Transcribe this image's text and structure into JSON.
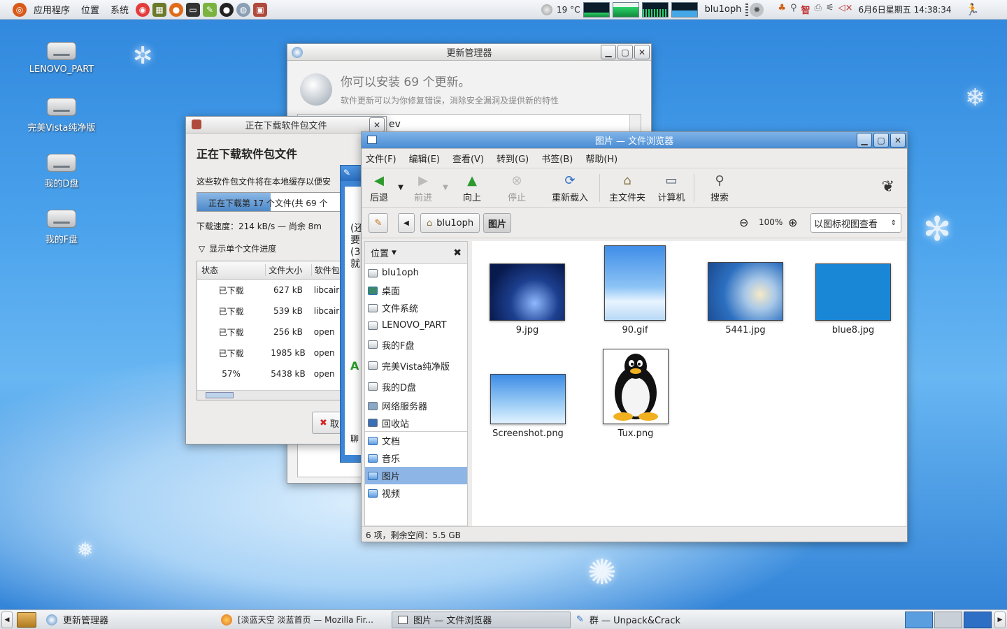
{
  "topbar": {
    "menus": [
      "应用程序",
      "位置",
      "系统"
    ],
    "temperature": "19 °C",
    "username": "blu1oph",
    "datetime": "6月6日星期五 14:38:34",
    "launchers": [
      "help-icon",
      "calculator-icon",
      "firefox-icon",
      "terminal-icon",
      "pidgin-icon",
      "qq-icon",
      "network-icon",
      "package-icon"
    ]
  },
  "desktop": {
    "icons": [
      "LENOVO_PART",
      "完美Vista纯净版",
      "我的D盘",
      "我的F盘"
    ]
  },
  "update_manager": {
    "title": "更新管理器",
    "heading": "你可以安装 69 个更新。",
    "subtitle": "软件更新可以为你修复错误，消除安全漏洞及提供新的特性",
    "list_text": "ev"
  },
  "download_dialog": {
    "title": "正在下载软件包文件",
    "heading": "正在下载软件包文件",
    "description": "这些软件包文件将在本地缓存以便安",
    "progress_text": "正在下载第 17 个文件(共 69 个",
    "progress": 0.41,
    "speed": "下载速度：214 kB/s — 尚余 8m",
    "toggle": "显示单个文件进度",
    "columns": [
      "状态",
      "文件大小",
      "软件包"
    ],
    "rows": [
      {
        "status": "已下载",
        "size": "627 kB",
        "pkg": "libcair"
      },
      {
        "status": "已下载",
        "size": "539 kB",
        "pkg": "libcair"
      },
      {
        "status": "已下载",
        "size": "256 kB",
        "pkg": "open"
      },
      {
        "status": "已下载",
        "size": "1985 kB",
        "pkg": "open"
      },
      {
        "status": "57%",
        "size": "5438 kB",
        "pkg": "open"
      }
    ],
    "cancel": "取"
  },
  "chat_window": {
    "lines": [
      "(还",
      "要",
      "(3",
      "就"
    ],
    "bottom_label": "聊"
  },
  "file_browser": {
    "title": "图片 — 文件浏览器",
    "menus": [
      "文件(F)",
      "编辑(E)",
      "查看(V)",
      "转到(G)",
      "书签(B)",
      "帮助(H)"
    ],
    "toolbar": {
      "back": "后退",
      "forward": "前进",
      "up": "向上",
      "stop": "停止",
      "reload": "重新载入",
      "home": "主文件夹",
      "computer": "计算机",
      "search": "搜索"
    },
    "path": [
      "blu1oph",
      "图片"
    ],
    "zoom": "100%",
    "view_mode": "以图标视图查看",
    "sidebar_title": "位置",
    "places": [
      "blu1oph",
      "桌面",
      "文件系统",
      "LENOVO_PART",
      "我的F盘",
      "完美Vista纯净版",
      "我的D盘",
      "网络服务器",
      "回收站"
    ],
    "bookmarks": [
      "文档",
      "音乐",
      "图片",
      "视频"
    ],
    "selected_bookmark": "图片",
    "files": [
      "9.jpg",
      "90.gif",
      "5441.jpg",
      "blue8.jpg",
      "Screenshot.png",
      "Tux.png"
    ],
    "status": "6 项，剩余空间：5.5 GB"
  },
  "taskbar": {
    "tasks": [
      "更新管理器",
      "[淡蓝天空 淡蓝首页 — Mozilla Fir...",
      "图片 — 文件浏览器",
      "群 — Unpack&Crack"
    ]
  }
}
